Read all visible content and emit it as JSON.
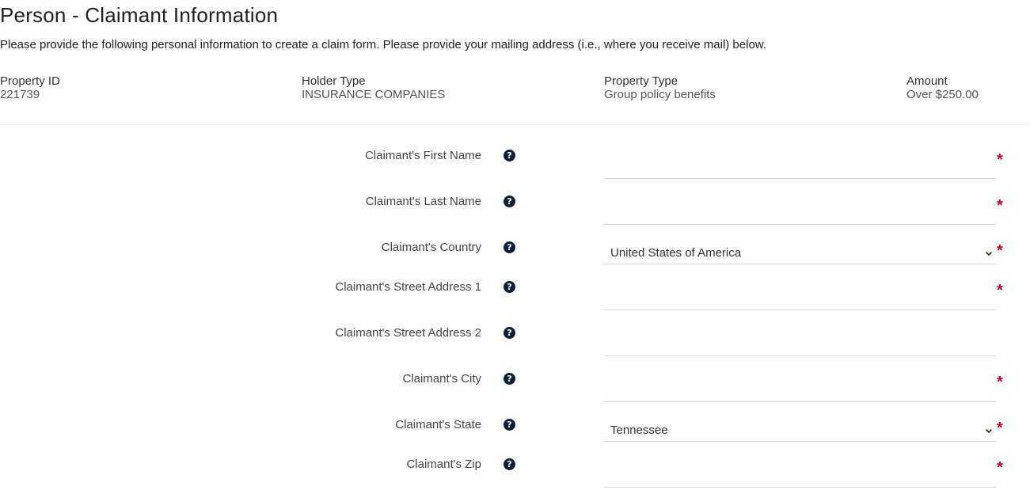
{
  "header": {
    "title": "Person - Claimant Information",
    "subtitle": "Please provide the following personal information to create a claim form. Please provide your mailing address (i.e., where you receive mail) below."
  },
  "summary": {
    "property_id": {
      "label": "Property ID",
      "value": "221739"
    },
    "holder_type": {
      "label": "Holder Type",
      "value": "INSURANCE COMPANIES"
    },
    "property_type": {
      "label": "Property Type",
      "value": "Group policy benefits"
    },
    "amount": {
      "label": "Amount",
      "value": "Over $250.00"
    }
  },
  "form": {
    "help_glyph": "?",
    "required_glyph": "*",
    "fields": [
      {
        "label": "Claimant's First Name",
        "value": ""
      },
      {
        "label": "Claimant's Last Name",
        "value": ""
      },
      {
        "label": "Claimant's Country",
        "value": "United States of America"
      },
      {
        "label": "Claimant's Street Address 1",
        "value": ""
      },
      {
        "label": "Claimant's Street Address 2",
        "value": ""
      },
      {
        "label": "Claimant's City",
        "value": ""
      },
      {
        "label": "Claimant's State",
        "value": "Tennessee"
      },
      {
        "label": "Claimant's Zip",
        "value": ""
      }
    ]
  },
  "colors": {
    "required": "#d0021b",
    "help_icon": "#0b1f3b",
    "field_border": "#d8d8d8"
  }
}
